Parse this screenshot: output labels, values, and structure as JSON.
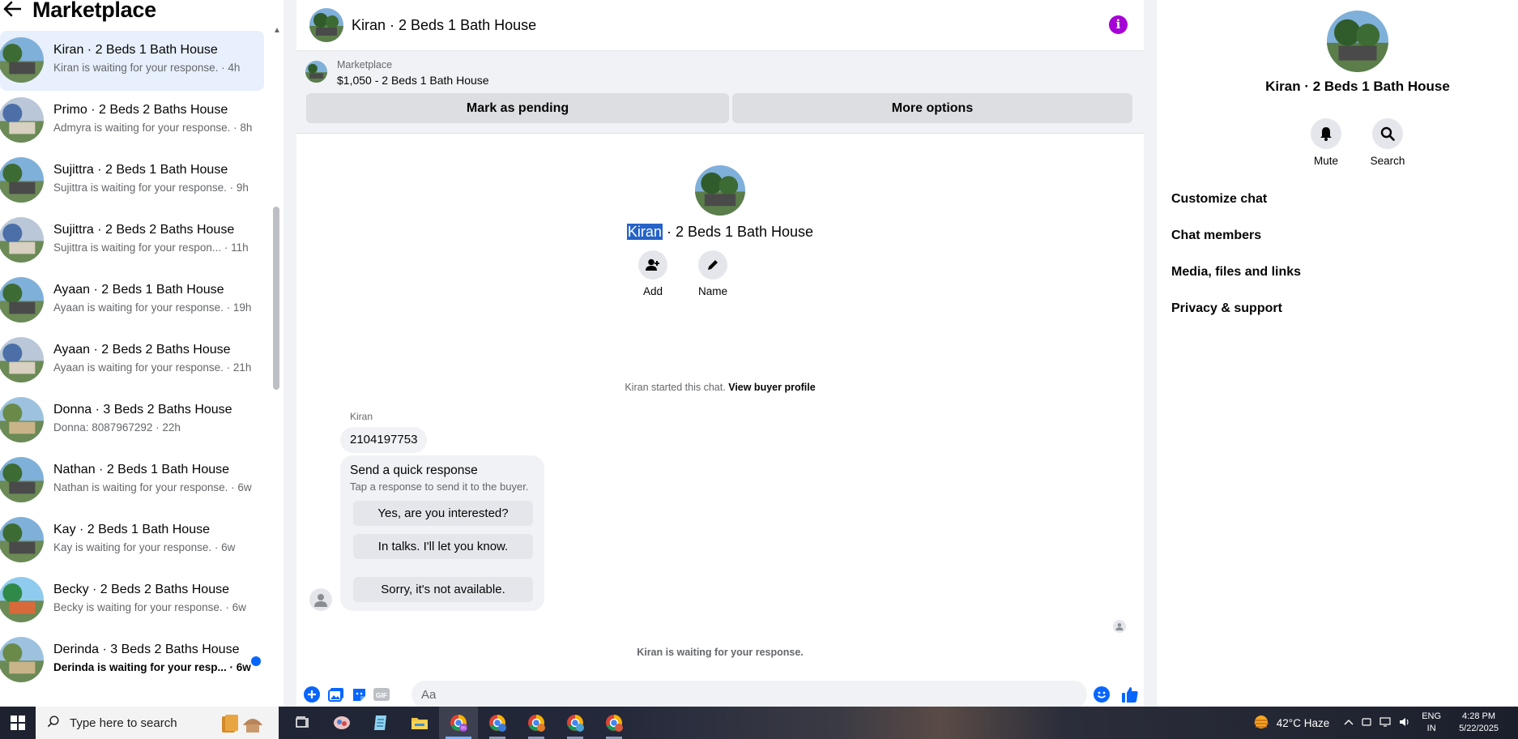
{
  "header": {
    "title": "Marketplace"
  },
  "conversations": [
    {
      "title": "Kiran · 2 Beds 1 Bath House",
      "subtitle": "Kiran is waiting for your response. · 4h",
      "active": true,
      "unread": false
    },
    {
      "title": "Primo · 2 Beds 2 Baths House",
      "subtitle": "Admyra is waiting for your response. · 8h",
      "active": false,
      "unread": false
    },
    {
      "title": "Sujittra · 2 Beds 1 Bath House",
      "subtitle": "Sujittra is waiting for your response. · 9h",
      "active": false,
      "unread": false
    },
    {
      "title": "Sujittra · 2 Beds 2 Baths House",
      "subtitle": "Sujittra is waiting for your respon...  · 11h",
      "active": false,
      "unread": false
    },
    {
      "title": "Ayaan · 2 Beds 1 Bath House",
      "subtitle": "Ayaan is waiting for your response. · 19h",
      "active": false,
      "unread": false
    },
    {
      "title": "Ayaan · 2 Beds 2 Baths House",
      "subtitle": "Ayaan is waiting for your response. · 21h",
      "active": false,
      "unread": false
    },
    {
      "title": "Donna · 3 Beds 2 Baths House",
      "subtitle": "Donna: 8087967292 · 22h",
      "active": false,
      "unread": false
    },
    {
      "title": "Nathan · 2 Beds 1 Bath House",
      "subtitle": "Nathan is waiting for your response. · 6w",
      "active": false,
      "unread": false
    },
    {
      "title": "Kay · 2 Beds 1 Bath House",
      "subtitle": "Kay is waiting for your response. · 6w",
      "active": false,
      "unread": false
    },
    {
      "title": "Becky · 2 Beds 2 Baths House",
      "subtitle": "Becky is waiting for your response. · 6w",
      "active": false,
      "unread": false
    },
    {
      "title": "Derinda · 3 Beds 2 Baths House",
      "subtitle": "Derinda is waiting for your resp... · 6w",
      "active": false,
      "unread": true
    }
  ],
  "chat": {
    "title": "Kiran · 2 Beds 1 Bath House",
    "listing": {
      "label": "Marketplace",
      "price_line": "$1,050 - 2 Beds 1 Bath House"
    },
    "buttons": {
      "pending": "Mark as pending",
      "more": "More options"
    },
    "intro": {
      "name_highlight": "Kiran",
      "name_rest": " · 2 Beds 1 Bath House",
      "add_label": "Add",
      "name_label": "Name"
    },
    "started_text": "Kiran started this chat.",
    "buyer_profile_link": "View buyer profile",
    "sender_name": "Kiran",
    "message": "2104197753",
    "quick_response": {
      "title": "Send a quick response",
      "subtitle": "Tap a response to send it to the buyer.",
      "options": [
        "Yes, are you interested?",
        "In talks. I'll let you know.",
        "Sorry, it's not available."
      ]
    },
    "waiting_text": "Kiran is waiting for your response.",
    "composer": {
      "placeholder": "Aa"
    }
  },
  "info_panel": {
    "name": "Kiran · 2 Beds 1 Bath House",
    "mute_label": "Mute",
    "search_label": "Search",
    "menu": [
      "Customize chat",
      "Chat members",
      "Media, files and links",
      "Privacy & support"
    ]
  },
  "taskbar": {
    "search_placeholder": "Type here to search",
    "weather": "42°C  Haze",
    "lang_top": "ENG",
    "lang_bottom": "IN",
    "time": "4:28 PM",
    "date": "5/22/2025"
  },
  "colors": {
    "accent_purple": "#a500d6",
    "messenger_blue": "#0866ff",
    "selection_highlight": "#2563c9"
  }
}
